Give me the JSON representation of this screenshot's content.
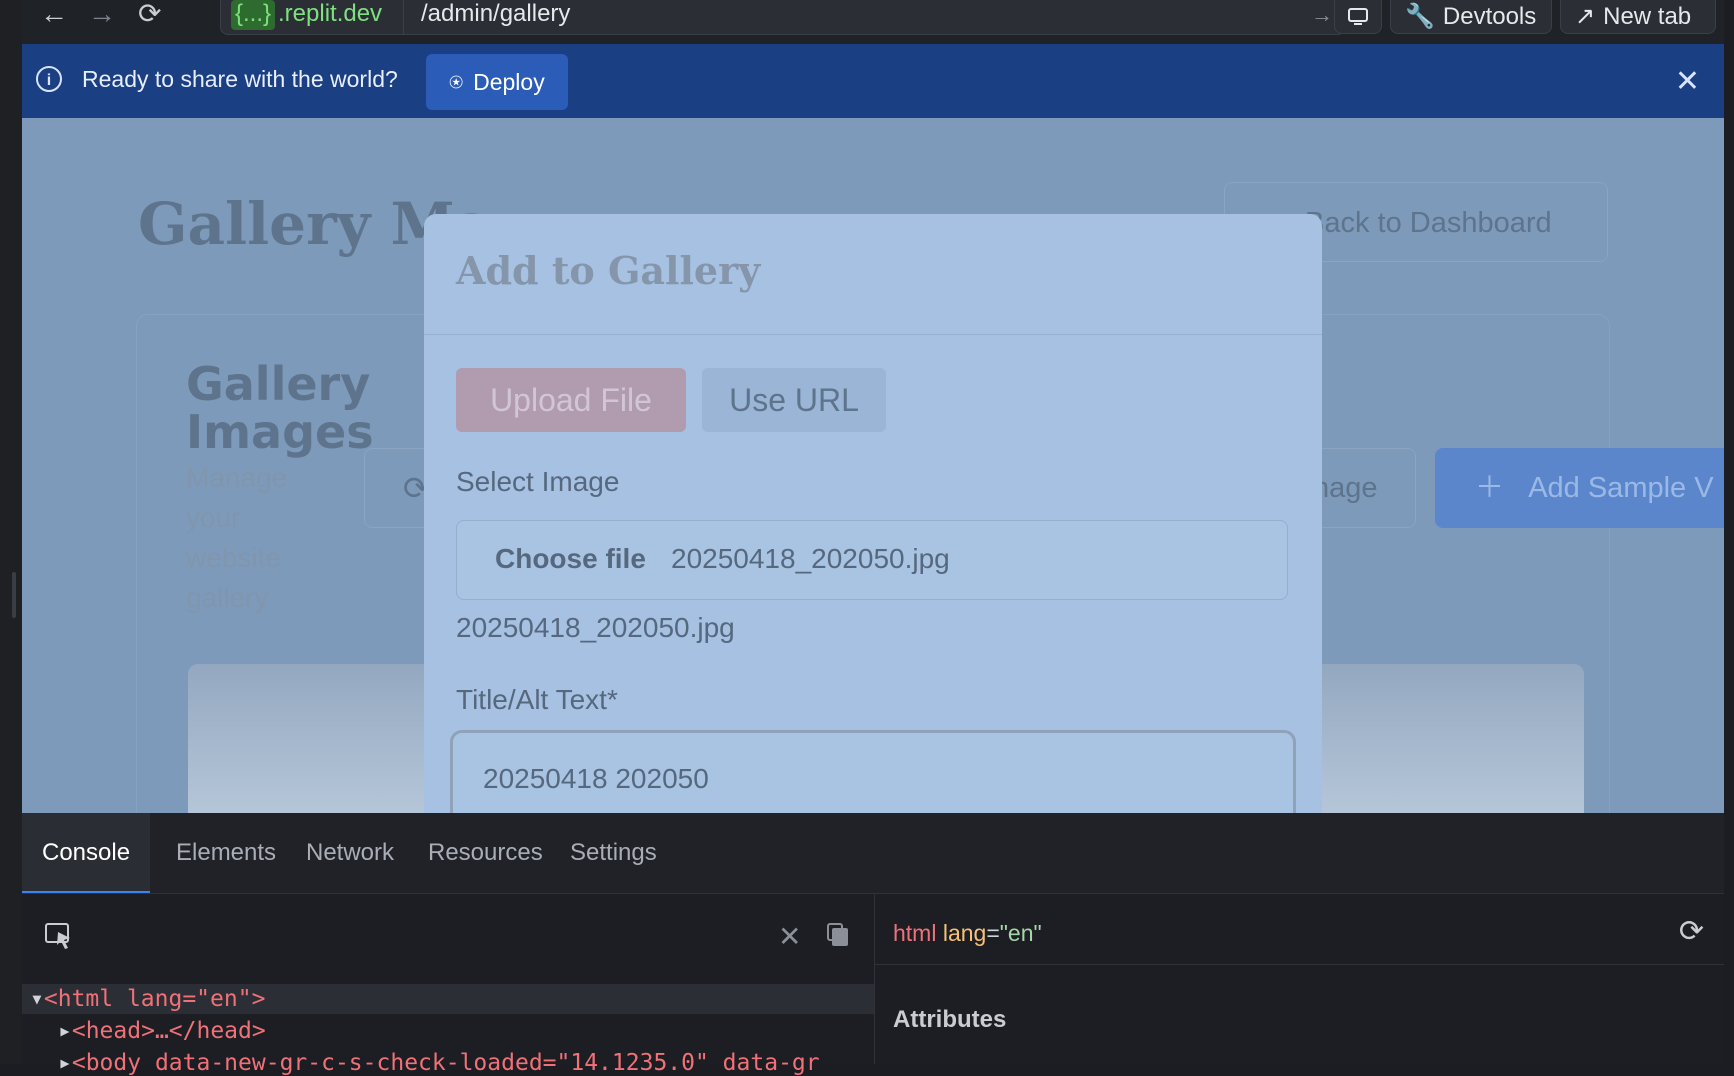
{
  "browser": {
    "host_badge": "{...}",
    "host_rest": ".replit.dev",
    "path": "/admin/gallery",
    "devtools_label": "Devtools",
    "new_tab_label": "New tab"
  },
  "banner": {
    "text": "Ready to share with the world?",
    "deploy_label": "Deploy"
  },
  "page": {
    "title": "Gallery Ma",
    "title_tail": "",
    "back_label": "Back to Dashboard",
    "section_title": "Gallery Images",
    "section_subtitle": "Manage your website gallery",
    "right_button_label": "nage",
    "add_sample_label": "Add Sample V"
  },
  "modal": {
    "title": "Add to Gallery",
    "tab_upload": "Upload File",
    "tab_url": "Use URL",
    "select_label": "Select Image",
    "choose_label": "Choose file",
    "file_name": "20250418_202050.jpg",
    "file_name_below": "20250418_202050.jpg",
    "title_label": "Title/Alt Text*",
    "title_value": "20250418 202050"
  },
  "devtools": {
    "tabs": [
      "Console",
      "Elements",
      "Network",
      "Resources",
      "Settings"
    ],
    "active_tab": "Console",
    "breadcrumb_tag": "html",
    "breadcrumb_attr": "lang",
    "breadcrumb_val": "\"en\"",
    "lines": [
      "<html lang=\"en\">",
      "<head>…</head>",
      "<body data-new-gr-c-s-check-loaded=\"14.1235.0\" data-gr"
    ],
    "attributes_heading": "Attributes"
  },
  "colors": {
    "banner": "#1a3f82",
    "deploy": "#2a5cb8",
    "accent_tab": "#3b82f6",
    "page_overlay": "#7d9aba"
  }
}
